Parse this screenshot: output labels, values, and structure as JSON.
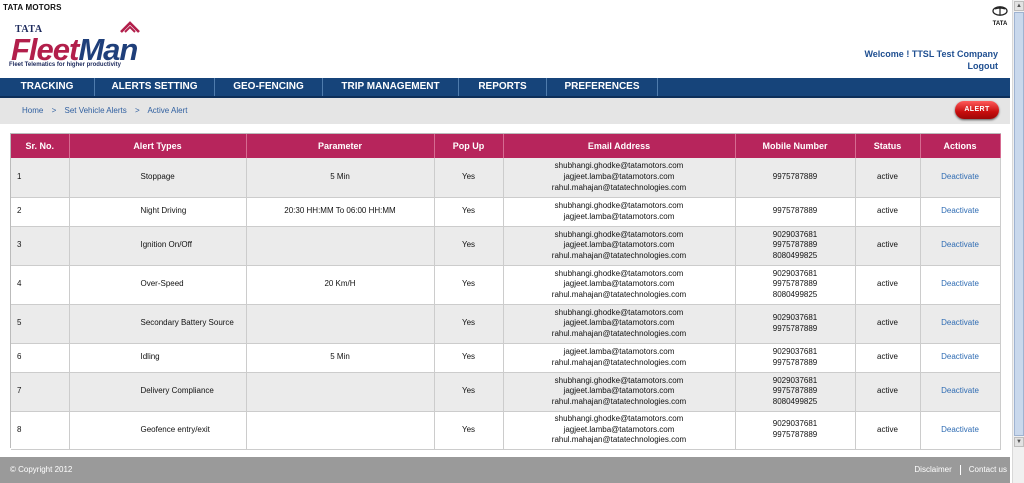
{
  "header": {
    "brand_small": "TATA MOTORS",
    "logo_tata": "TATA",
    "logo_fleet": "Fleet",
    "logo_man": "Man",
    "tagline": "Fleet Telematics for higher productivity",
    "right_logo_text": "TATA",
    "welcome": "Welcome ! TTSL Test Company",
    "logout": "Logout"
  },
  "nav": {
    "items": [
      "TRACKING",
      "ALERTS SETTING",
      "GEO-FENCING",
      "TRIP MANAGEMENT",
      "REPORTS",
      "PREFERENCES"
    ]
  },
  "breadcrumb": {
    "home": "Home",
    "sep": ">",
    "parent": "Set Vehicle Alerts",
    "current": "Active Alert"
  },
  "alert_button": "ALERT",
  "table": {
    "headers": [
      "Sr. No.",
      "Alert Types",
      "Parameter",
      "Pop Up",
      "Email Address",
      "Mobile Number",
      "Status",
      "Actions"
    ],
    "rows": [
      {
        "sr": "1",
        "type": "Stoppage",
        "param": "5 Min",
        "popup": "Yes",
        "emails": [
          "shubhangi.ghodke@tatamotors.com",
          "jagjeet.lamba@tatamotors.com",
          "rahul.mahajan@tatatechnologies.com"
        ],
        "mobiles": [
          "9975787889"
        ],
        "status": "active",
        "action": "Deactivate"
      },
      {
        "sr": "2",
        "type": "Night Driving",
        "param": "20:30 HH:MM To 06:00 HH:MM",
        "popup": "Yes",
        "emails": [
          "shubhangi.ghodke@tatamotors.com",
          "jagjeet.lamba@tatamotors.com"
        ],
        "mobiles": [
          "9975787889"
        ],
        "status": "active",
        "action": "Deactivate"
      },
      {
        "sr": "3",
        "type": "Ignition On/Off",
        "param": "",
        "popup": "Yes",
        "emails": [
          "shubhangi.ghodke@tatamotors.com",
          "jagjeet.lamba@tatamotors.com",
          "rahul.mahajan@tatatechnologies.com"
        ],
        "mobiles": [
          "9029037681",
          "9975787889",
          "8080499825"
        ],
        "status": "active",
        "action": "Deactivate"
      },
      {
        "sr": "4",
        "type": "Over-Speed",
        "param": "20 Km/H",
        "popup": "Yes",
        "emails": [
          "shubhangi.ghodke@tatamotors.com",
          "jagjeet.lamba@tatamotors.com",
          "rahul.mahajan@tatatechnologies.com"
        ],
        "mobiles": [
          "9029037681",
          "9975787889",
          "8080499825"
        ],
        "status": "active",
        "action": "Deactivate"
      },
      {
        "sr": "5",
        "type": "Secondary Battery Source",
        "param": "",
        "popup": "Yes",
        "emails": [
          "shubhangi.ghodke@tatamotors.com",
          "jagjeet.lamba@tatamotors.com",
          "rahul.mahajan@tatatechnologies.com"
        ],
        "mobiles": [
          "9029037681",
          "9975787889"
        ],
        "status": "active",
        "action": "Deactivate"
      },
      {
        "sr": "6",
        "type": "Idling",
        "param": "5 Min",
        "popup": "Yes",
        "emails": [
          "jagjeet.lamba@tatamotors.com",
          "rahul.mahajan@tatatechnologies.com"
        ],
        "mobiles": [
          "9029037681",
          "9975787889"
        ],
        "status": "active",
        "action": "Deactivate"
      },
      {
        "sr": "7",
        "type": "Delivery Compliance",
        "param": "",
        "popup": "Yes",
        "emails": [
          "shubhangi.ghodke@tatamotors.com",
          "jagjeet.lamba@tatamotors.com",
          "rahul.mahajan@tatatechnologies.com"
        ],
        "mobiles": [
          "9029037681",
          "9975787889",
          "8080499825"
        ],
        "status": "active",
        "action": "Deactivate"
      },
      {
        "sr": "8",
        "type": "Geofence entry/exit",
        "param": "",
        "popup": "Yes",
        "emails": [
          "shubhangi.ghodke@tatamotors.com",
          "jagjeet.lamba@tatamotors.com",
          "rahul.mahajan@tatatechnologies.com"
        ],
        "mobiles": [
          "9029037681",
          "9975787889"
        ],
        "status": "active",
        "action": "Deactivate"
      }
    ]
  },
  "footer": {
    "copyright": "© Copyright 2012",
    "disclaimer": "Disclaimer",
    "contact": "Contact us"
  },
  "colors": {
    "nav": "#16447a",
    "table_header": "#b7255c",
    "link": "#2f6cb3",
    "footer": "#9a9a9a"
  },
  "icons": [
    "tata-logo-icon",
    "fleetman-roof-icon",
    "scroll-up-icon",
    "scroll-down-icon"
  ]
}
